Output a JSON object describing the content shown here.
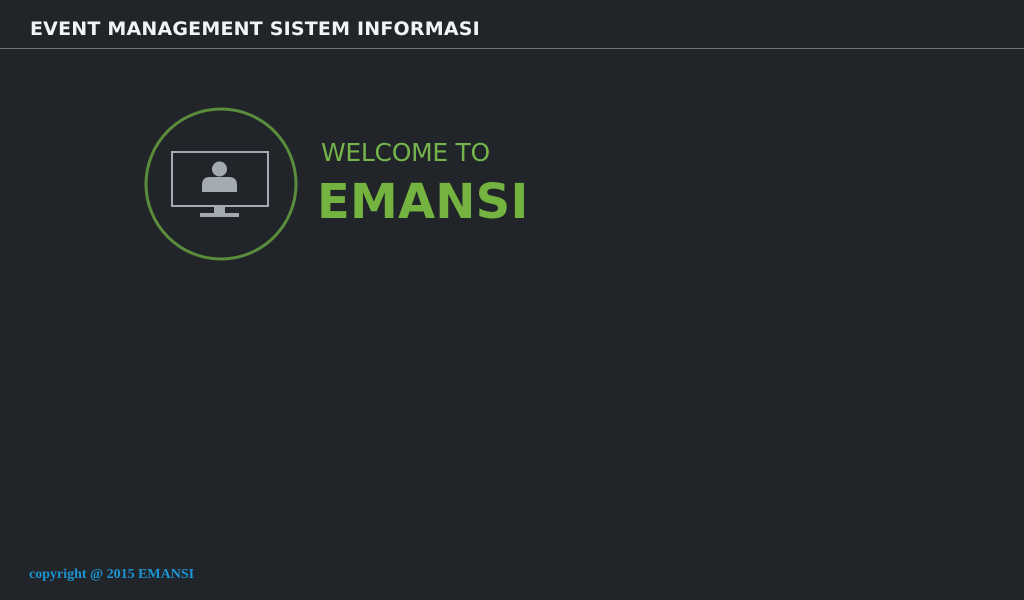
{
  "header": {
    "title": "EVENT MANAGEMENT SISTEM INFORMASI"
  },
  "hero": {
    "icon": "monitor-user-icon",
    "welcome_text": "WELCOME TO",
    "brand": "EMANSI"
  },
  "footer": {
    "copyright": "copyright @ 2015 EMANSI"
  },
  "colors": {
    "background": "#212529",
    "accent_green": "#74b33f",
    "header_text": "#f1f3f4",
    "footer_link": "#1d93d2",
    "icon_gray": "#99a3ad"
  }
}
